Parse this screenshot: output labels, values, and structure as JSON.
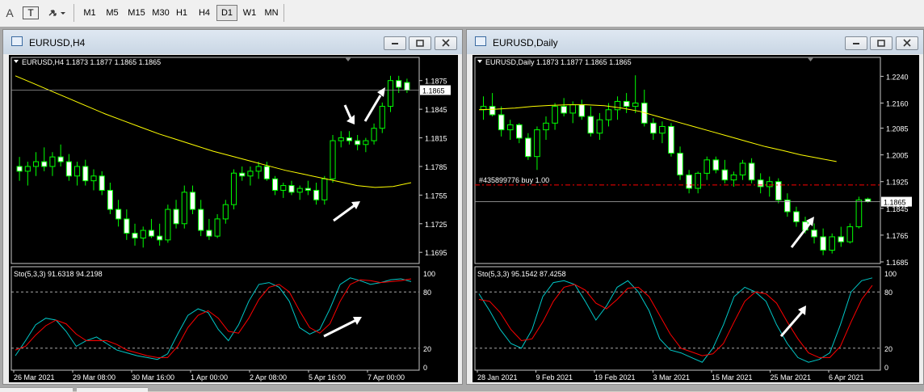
{
  "toolbar": {
    "text_icon": "A",
    "textbox_icon": "T",
    "timeframes": [
      "M1",
      "M5",
      "M15",
      "M30",
      "H1",
      "H4",
      "D1",
      "W1",
      "MN"
    ],
    "active_timeframe": "D1"
  },
  "windows": [
    {
      "title": "EURUSD,H4",
      "info": "EURUSD,H4  1.1873 1.1877 1.1865 1.1865",
      "price_ticks": [
        "1.1875",
        "1.1845",
        "1.1815",
        "1.1785",
        "1.1755",
        "1.1725",
        "1.1695"
      ],
      "current_price": "1.1865",
      "stoch_info": "Sto(5,3,3) 91.6318 94.2198",
      "stoch_ticks": [
        "100",
        "80",
        "20",
        "0"
      ],
      "time_ticks": [
        "26 Mar 2021",
        "29 Mar 08:00",
        "30 Mar 16:00",
        "1 Apr 00:00",
        "2 Apr 08:00",
        "5 Apr 16:00",
        "7 Apr 00:00"
      ]
    },
    {
      "title": "EURUSD,Daily",
      "info": "EURUSD,Daily  1.1873 1.1877 1.1865 1.1865",
      "price_ticks": [
        "1.2240",
        "1.2160",
        "1.2085",
        "1.2005",
        "1.1925",
        "1.1845",
        "1.1765",
        "1.1685"
      ],
      "current_price": "1.1865",
      "order_label": "#435899776 buy 1.00",
      "stoch_info": "Sto(5,3,3) 95.1542 87.4258",
      "stoch_ticks": [
        "100",
        "80",
        "20",
        "0"
      ],
      "time_ticks": [
        "28 Jan 2021",
        "9 Feb 2021",
        "19 Feb 2021",
        "3 Mar 2021",
        "15 Mar 2021",
        "25 Mar 2021",
        "6 Apr 2021"
      ]
    }
  ],
  "chart_data": [
    {
      "type": "candlestick",
      "title": "EURUSD,H4",
      "ylim": [
        1.1685,
        1.189
      ],
      "candles_ohlc": [
        [
          1.1785,
          1.1795,
          1.177,
          1.178
        ],
        [
          1.178,
          1.179,
          1.1765,
          1.1785
        ],
        [
          1.1785,
          1.18,
          1.1775,
          1.179
        ],
        [
          1.179,
          1.1805,
          1.178,
          1.1785
        ],
        [
          1.1785,
          1.18,
          1.1775,
          1.1795
        ],
        [
          1.1795,
          1.1808,
          1.1785,
          1.179
        ],
        [
          1.179,
          1.1798,
          1.177,
          1.1775
        ],
        [
          1.1775,
          1.179,
          1.1765,
          1.1785
        ],
        [
          1.1785,
          1.1792,
          1.1765,
          1.177
        ],
        [
          1.177,
          1.1782,
          1.176,
          1.1775
        ],
        [
          1.1775,
          1.178,
          1.1755,
          1.176
        ],
        [
          1.176,
          1.1768,
          1.1735,
          1.174
        ],
        [
          1.174,
          1.175,
          1.1722,
          1.173
        ],
        [
          1.173,
          1.174,
          1.1708,
          1.1715
        ],
        [
          1.1715,
          1.1725,
          1.1702,
          1.171
        ],
        [
          1.171,
          1.1722,
          1.17,
          1.1718
        ],
        [
          1.1718,
          1.173,
          1.171,
          1.1712
        ],
        [
          1.1712,
          1.1725,
          1.1702,
          1.1708
        ],
        [
          1.1708,
          1.1745,
          1.1705,
          1.174
        ],
        [
          1.174,
          1.175,
          1.172,
          1.1725
        ],
        [
          1.1725,
          1.1765,
          1.172,
          1.1758
        ],
        [
          1.1758,
          1.1765,
          1.1735,
          1.174
        ],
        [
          1.174,
          1.175,
          1.1712,
          1.1718
        ],
        [
          1.1718,
          1.173,
          1.1708,
          1.1712
        ],
        [
          1.1712,
          1.1735,
          1.171,
          1.173
        ],
        [
          1.173,
          1.175,
          1.1725,
          1.1745
        ],
        [
          1.1745,
          1.1782,
          1.174,
          1.1778
        ],
        [
          1.1778,
          1.1785,
          1.177,
          1.1775
        ],
        [
          1.1775,
          1.1785,
          1.1765,
          1.178
        ],
        [
          1.178,
          1.179,
          1.1772,
          1.1785
        ],
        [
          1.1785,
          1.179,
          1.177,
          1.1772
        ],
        [
          1.1772,
          1.1775,
          1.1755,
          1.176
        ],
        [
          1.176,
          1.1768,
          1.1752,
          1.1765
        ],
        [
          1.1765,
          1.177,
          1.1755,
          1.1758
        ],
        [
          1.1758,
          1.1765,
          1.175,
          1.1762
        ],
        [
          1.1762,
          1.177,
          1.1755,
          1.176
        ],
        [
          1.176,
          1.1768,
          1.1745,
          1.175
        ],
        [
          1.175,
          1.1775,
          1.1745,
          1.1772
        ],
        [
          1.1772,
          1.1818,
          1.1768,
          1.1812
        ],
        [
          1.1812,
          1.1822,
          1.1805,
          1.1815
        ],
        [
          1.1815,
          1.1822,
          1.1808,
          1.1812
        ],
        [
          1.1812,
          1.1818,
          1.1802,
          1.1808
        ],
        [
          1.1808,
          1.1815,
          1.18,
          1.1812
        ],
        [
          1.1812,
          1.183,
          1.1808,
          1.1825
        ],
        [
          1.1825,
          1.1852,
          1.182,
          1.1848
        ],
        [
          1.1848,
          1.188,
          1.1842,
          1.1875
        ],
        [
          1.1875,
          1.188,
          1.1862,
          1.1868
        ],
        [
          1.1873,
          1.1877,
          1.1862,
          1.1865
        ]
      ],
      "ma_line": [
        1.188,
        1.1872,
        1.1864,
        1.1856,
        1.1848,
        1.184,
        1.1833,
        1.1826,
        1.1819,
        1.1813,
        1.1807,
        1.1801,
        1.1796,
        1.1791,
        1.1786,
        1.1781,
        1.1777,
        1.1773,
        1.1769,
        1.1765,
        1.1763,
        1.1764,
        1.1768
      ],
      "stoch_main": [
        12,
        28,
        45,
        52,
        50,
        38,
        22,
        28,
        32,
        25,
        18,
        15,
        12,
        10,
        8,
        14,
        35,
        55,
        62,
        58,
        40,
        28,
        45,
        70,
        88,
        90,
        85,
        70,
        42,
        35,
        40,
        62,
        88,
        95,
        92,
        88,
        90,
        93,
        94,
        91
      ],
      "stoch_signal": [
        18,
        22,
        34,
        44,
        50,
        46,
        35,
        28,
        28,
        28,
        24,
        18,
        15,
        12,
        10,
        10,
        22,
        42,
        55,
        60,
        52,
        38,
        36,
        52,
        72,
        85,
        88,
        80,
        60,
        42,
        36,
        46,
        70,
        88,
        93,
        92,
        90,
        91,
        92,
        94
      ],
      "stoch_levels": [
        80,
        20
      ]
    },
    {
      "type": "candlestick",
      "title": "EURUSD,Daily",
      "ylim": [
        1.1685,
        1.227
      ],
      "candles_ohlc": [
        [
          1.214,
          1.218,
          1.211,
          1.215
        ],
        [
          1.215,
          1.219,
          1.212,
          1.2125
        ],
        [
          1.2125,
          1.215,
          1.206,
          1.208
        ],
        [
          1.208,
          1.211,
          1.205,
          1.2095
        ],
        [
          1.2095,
          1.21,
          1.204,
          1.2055
        ],
        [
          1.2055,
          1.207,
          1.199,
          1.2
        ],
        [
          1.2,
          1.209,
          1.196,
          1.208
        ],
        [
          1.208,
          1.212,
          1.205,
          1.21
        ],
        [
          1.21,
          1.216,
          1.208,
          1.215
        ],
        [
          1.215,
          1.2175,
          1.212,
          1.213
        ],
        [
          1.213,
          1.2165,
          1.21,
          1.2155
        ],
        [
          1.2155,
          1.217,
          1.211,
          1.212
        ],
        [
          1.212,
          1.215,
          1.206,
          1.207
        ],
        [
          1.207,
          1.213,
          1.205,
          1.211
        ],
        [
          1.211,
          1.216,
          1.209,
          1.214
        ],
        [
          1.214,
          1.218,
          1.211,
          1.2165
        ],
        [
          1.2165,
          1.219,
          1.213,
          1.215
        ],
        [
          1.215,
          1.2243,
          1.213,
          1.216
        ],
        [
          1.216,
          1.22,
          1.209,
          1.21
        ],
        [
          1.21,
          1.2115,
          1.205,
          1.207
        ],
        [
          1.207,
          1.2105,
          1.204,
          1.209
        ],
        [
          1.209,
          1.21,
          1.2,
          1.201
        ],
        [
          1.201,
          1.203,
          1.193,
          1.1945
        ],
        [
          1.1945,
          1.196,
          1.189,
          1.1905
        ],
        [
          1.1905,
          1.1955,
          1.189,
          1.195
        ],
        [
          1.195,
          1.2,
          1.193,
          1.199
        ],
        [
          1.199,
          1.2,
          1.195,
          1.196
        ],
        [
          1.196,
          1.199,
          1.192,
          1.193
        ],
        [
          1.193,
          1.1955,
          1.191,
          1.1945
        ],
        [
          1.1945,
          1.199,
          1.193,
          1.198
        ],
        [
          1.198,
          1.1995,
          1.192,
          1.193
        ],
        [
          1.193,
          1.195,
          1.189,
          1.191
        ],
        [
          1.191,
          1.194,
          1.188,
          1.1925
        ],
        [
          1.1925,
          1.1935,
          1.186,
          1.187
        ],
        [
          1.187,
          1.189,
          1.182,
          1.1835
        ],
        [
          1.1835,
          1.185,
          1.179,
          1.1805
        ],
        [
          1.1805,
          1.182,
          1.177,
          1.178
        ],
        [
          1.178,
          1.18,
          1.174,
          1.176
        ],
        [
          1.176,
          1.1785,
          1.1705,
          1.172
        ],
        [
          1.172,
          1.177,
          1.171,
          1.176
        ],
        [
          1.176,
          1.179,
          1.173,
          1.1745
        ],
        [
          1.1745,
          1.18,
          1.174,
          1.179
        ],
        [
          1.179,
          1.188,
          1.1785,
          1.187
        ],
        [
          1.1873,
          1.1877,
          1.1862,
          1.1865
        ]
      ],
      "ma_line": [
        1.214,
        1.2142,
        1.2145,
        1.215,
        1.2153,
        1.2155,
        1.2155,
        1.2152,
        1.2145,
        1.2135,
        1.212,
        1.2105,
        1.209,
        1.2075,
        1.206,
        1.2045,
        1.203,
        1.2018,
        1.2005,
        1.1995,
        1.1985
      ],
      "order_level": 1.1915,
      "stoch_main": [
        78,
        60,
        40,
        25,
        20,
        40,
        75,
        90,
        92,
        88,
        70,
        50,
        65,
        85,
        92,
        80,
        60,
        30,
        18,
        15,
        10,
        5,
        20,
        45,
        75,
        85,
        80,
        70,
        45,
        25,
        10,
        5,
        8,
        15,
        45,
        80,
        92,
        95
      ],
      "stoch_signal": [
        72,
        70,
        58,
        40,
        28,
        30,
        48,
        70,
        85,
        88,
        82,
        68,
        62,
        72,
        84,
        85,
        75,
        55,
        35,
        20,
        16,
        12,
        14,
        25,
        48,
        70,
        80,
        78,
        68,
        48,
        30,
        15,
        10,
        10,
        22,
        48,
        72,
        87
      ],
      "stoch_levels": [
        80,
        20
      ]
    }
  ],
  "colors": {
    "bull": "#00ff00",
    "bear": "#ffffff",
    "ma": "#ffff00",
    "stoch_main": "#00c8c8",
    "stoch_signal": "#ff0000",
    "order_line": "#ff0000"
  }
}
